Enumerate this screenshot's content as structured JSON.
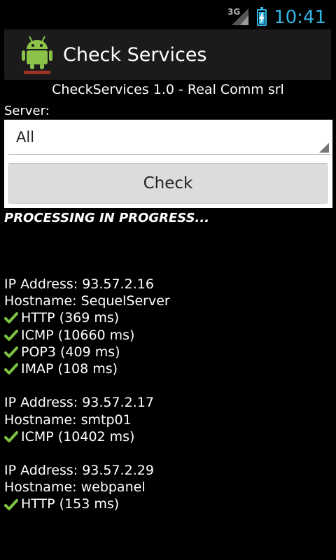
{
  "status_bar": {
    "network": "3G",
    "time": "10:41"
  },
  "action_bar": {
    "title": "Check Services"
  },
  "subtitle": "CheckServices 1.0 - Real Comm srl",
  "server": {
    "label": "Server:",
    "selected": "All"
  },
  "check_button": "Check",
  "processing_text": "PROCESSING IN PROGRESS...",
  "results": [
    {
      "ip": "IP Address: 93.57.2.16",
      "hostname": "Hostname: SequelServer",
      "services": [
        "HTTP (369 ms)",
        "ICMP (10660 ms)",
        "POP3 (409 ms)",
        "IMAP (108 ms)"
      ]
    },
    {
      "ip": "IP Address: 93.57.2.17",
      "hostname": "Hostname: smtp01",
      "services": [
        "ICMP (10402 ms)"
      ]
    },
    {
      "ip": "IP Address: 93.57.2.29",
      "hostname": "Hostname: webpanel",
      "services": [
        "HTTP (153 ms)"
      ]
    }
  ],
  "colors": {
    "accent": "#33b5e5",
    "check": "#7dc242"
  }
}
